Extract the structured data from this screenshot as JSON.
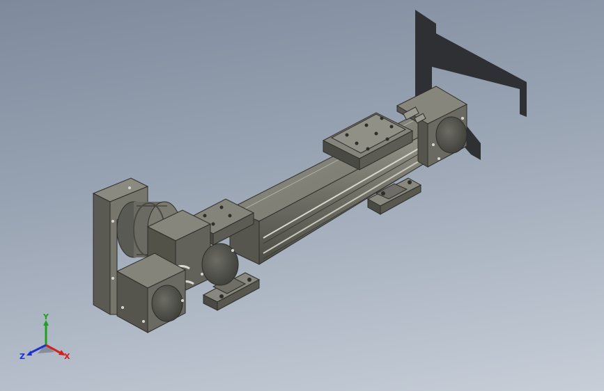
{
  "viewport": {
    "background_top": "#7e8a9c",
    "background_bottom": "#c7ced8"
  },
  "model": {
    "description_icon": "linear-actuator-model",
    "body_color": "#6e6e66",
    "body_dark": "#4a4a44",
    "body_light": "#8c8c82",
    "shadow_color": "#2e3034"
  },
  "triad": {
    "x_label": "X",
    "y_label": "Y",
    "z_label": "Z",
    "x_color": "#d02020",
    "y_color": "#20a020",
    "z_color": "#2030d0"
  }
}
